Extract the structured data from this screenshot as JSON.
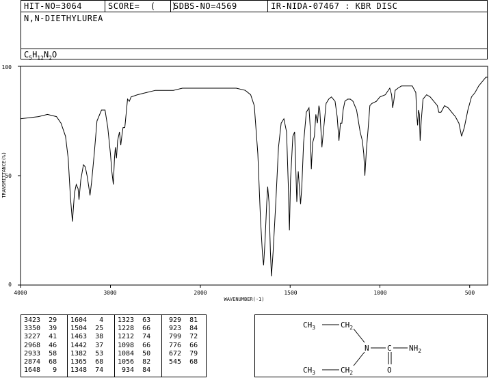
{
  "header": {
    "hit_no": "HIT-NO=3064",
    "score": "SCORE=  (   )",
    "sdbs_no": "SDBS-NO=4569",
    "ir_info": "IR-NIDA-07467 : KBR DISC",
    "compound_name": "N,N-DIETHYLUREA",
    "formula": {
      "c": "C",
      "c_n": "5",
      "h": "H",
      "h_n": "12",
      "n": "N",
      "n_n": "2",
      "o": "O"
    }
  },
  "chart_data": {
    "type": "line",
    "xlabel": "WAVENUMBER(-1)",
    "ylabel": "TRANSMITTANCE(%)",
    "xlim": [
      4000,
      400
    ],
    "ylim": [
      0,
      100
    ],
    "x_ticks": [
      "4000",
      "3000",
      "2000",
      "1500",
      "1000",
      "500"
    ],
    "y_ticks": [
      "100",
      "50",
      "0"
    ],
    "series": [
      {
        "points": [
          [
            4000,
            76
          ],
          [
            3800,
            77
          ],
          [
            3700,
            78
          ],
          [
            3600,
            77
          ],
          [
            3550,
            74
          ],
          [
            3500,
            68
          ],
          [
            3470,
            58
          ],
          [
            3445,
            40
          ],
          [
            3423,
            29
          ],
          [
            3400,
            42
          ],
          [
            3380,
            46
          ],
          [
            3360,
            44
          ],
          [
            3350,
            39
          ],
          [
            3330,
            48
          ],
          [
            3300,
            55
          ],
          [
            3280,
            54
          ],
          [
            3260,
            50
          ],
          [
            3245,
            46
          ],
          [
            3227,
            41
          ],
          [
            3210,
            47
          ],
          [
            3180,
            60
          ],
          [
            3150,
            75
          ],
          [
            3100,
            80
          ],
          [
            3060,
            80
          ],
          [
            3030,
            72
          ],
          [
            3000,
            60
          ],
          [
            2985,
            52
          ],
          [
            2968,
            46
          ],
          [
            2955,
            58
          ],
          [
            2945,
            63
          ],
          [
            2933,
            58
          ],
          [
            2920,
            66
          ],
          [
            2900,
            70
          ],
          [
            2885,
            64
          ],
          [
            2874,
            68
          ],
          [
            2860,
            72
          ],
          [
            2840,
            72
          ],
          [
            2810,
            85
          ],
          [
            2790,
            84
          ],
          [
            2770,
            86
          ],
          [
            2700,
            87
          ],
          [
            2600,
            88
          ],
          [
            2500,
            89
          ],
          [
            2400,
            89
          ],
          [
            2300,
            89
          ],
          [
            2200,
            90
          ],
          [
            2000,
            90
          ],
          [
            1900,
            90
          ],
          [
            1800,
            90
          ],
          [
            1750,
            89
          ],
          [
            1720,
            87
          ],
          [
            1700,
            82
          ],
          [
            1680,
            60
          ],
          [
            1665,
            30
          ],
          [
            1654,
            14
          ],
          [
            1648,
            9
          ],
          [
            1640,
            20
          ],
          [
            1630,
            38
          ],
          [
            1625,
            45
          ],
          [
            1618,
            38
          ],
          [
            1610,
            15
          ],
          [
            1604,
            4
          ],
          [
            1595,
            15
          ],
          [
            1580,
            38
          ],
          [
            1565,
            63
          ],
          [
            1550,
            74
          ],
          [
            1535,
            76
          ],
          [
            1520,
            70
          ],
          [
            1510,
            45
          ],
          [
            1504,
            25
          ],
          [
            1498,
            48
          ],
          [
            1485,
            68
          ],
          [
            1475,
            70
          ],
          [
            1463,
            38
          ],
          [
            1455,
            52
          ],
          [
            1442,
            37
          ],
          [
            1435,
            45
          ],
          [
            1425,
            65
          ],
          [
            1410,
            79
          ],
          [
            1395,
            81
          ],
          [
            1388,
            72
          ],
          [
            1382,
            53
          ],
          [
            1375,
            65
          ],
          [
            1365,
            68
          ],
          [
            1357,
            78
          ],
          [
            1348,
            74
          ],
          [
            1340,
            82
          ],
          [
            1335,
            80
          ],
          [
            1323,
            63
          ],
          [
            1315,
            70
          ],
          [
            1300,
            83
          ],
          [
            1285,
            85
          ],
          [
            1270,
            86
          ],
          [
            1250,
            84
          ],
          [
            1238,
            77
          ],
          [
            1228,
            66
          ],
          [
            1220,
            74
          ],
          [
            1212,
            74
          ],
          [
            1205,
            80
          ],
          [
            1195,
            84
          ],
          [
            1180,
            85
          ],
          [
            1165,
            85
          ],
          [
            1150,
            84
          ],
          [
            1130,
            80
          ],
          [
            1110,
            70
          ],
          [
            1098,
            66
          ],
          [
            1090,
            60
          ],
          [
            1084,
            50
          ],
          [
            1075,
            62
          ],
          [
            1065,
            72
          ],
          [
            1056,
            82
          ],
          [
            1045,
            83
          ],
          [
            1020,
            84
          ],
          [
            1000,
            86
          ],
          [
            970,
            87
          ],
          [
            945,
            90
          ],
          [
            935,
            87
          ],
          [
            929,
            81
          ],
          [
            923,
            84
          ],
          [
            915,
            89
          ],
          [
            900,
            90
          ],
          [
            880,
            91
          ],
          [
            860,
            91
          ],
          [
            840,
            91
          ],
          [
            820,
            91
          ],
          [
            800,
            88
          ],
          [
            795,
            78
          ],
          [
            790,
            73
          ],
          [
            785,
            80
          ],
          [
            780,
            78
          ],
          [
            776,
            66
          ],
          [
            770,
            75
          ],
          [
            760,
            85
          ],
          [
            740,
            87
          ],
          [
            720,
            86
          ],
          [
            700,
            84
          ],
          [
            680,
            82
          ],
          [
            672,
            79
          ],
          [
            660,
            79
          ],
          [
            640,
            82
          ],
          [
            620,
            81
          ],
          [
            600,
            79
          ],
          [
            580,
            77
          ],
          [
            560,
            74
          ],
          [
            545,
            68
          ],
          [
            530,
            72
          ],
          [
            510,
            80
          ],
          [
            490,
            86
          ],
          [
            470,
            88
          ],
          [
            450,
            91
          ],
          [
            430,
            93
          ],
          [
            410,
            95
          ],
          [
            400,
            95
          ]
        ]
      }
    ]
  },
  "peaks": [
    [
      "3423",
      "29"
    ],
    [
      "3350",
      "39"
    ],
    [
      "3227",
      "41"
    ],
    [
      "2968",
      "46"
    ],
    [
      "2933",
      "58"
    ],
    [
      "2874",
      "68"
    ],
    [
      "1648",
      "9"
    ],
    [
      "1604",
      "4"
    ],
    [
      "1504",
      "25"
    ],
    [
      "1463",
      "38"
    ],
    [
      "1442",
      "37"
    ],
    [
      "1382",
      "53"
    ],
    [
      "1365",
      "68"
    ],
    [
      "1348",
      "74"
    ],
    [
      "1323",
      "63"
    ],
    [
      "1228",
      "66"
    ],
    [
      "1212",
      "74"
    ],
    [
      "1098",
      "66"
    ],
    [
      "1084",
      "50"
    ],
    [
      "1056",
      "82"
    ],
    [
      "934",
      "84"
    ],
    [
      "929",
      "81"
    ],
    [
      "923",
      "84"
    ],
    [
      "799",
      "72"
    ],
    [
      "776",
      "66"
    ],
    [
      "672",
      "79"
    ],
    [
      "545",
      "68"
    ]
  ],
  "structure": {
    "ch3_top": "CH3",
    "ch2_top": "CH2",
    "n": "N",
    "c": "C",
    "nh2": "NH2",
    "o": "O",
    "ch3_bot": "CH3",
    "ch2_bot": "CH2"
  }
}
